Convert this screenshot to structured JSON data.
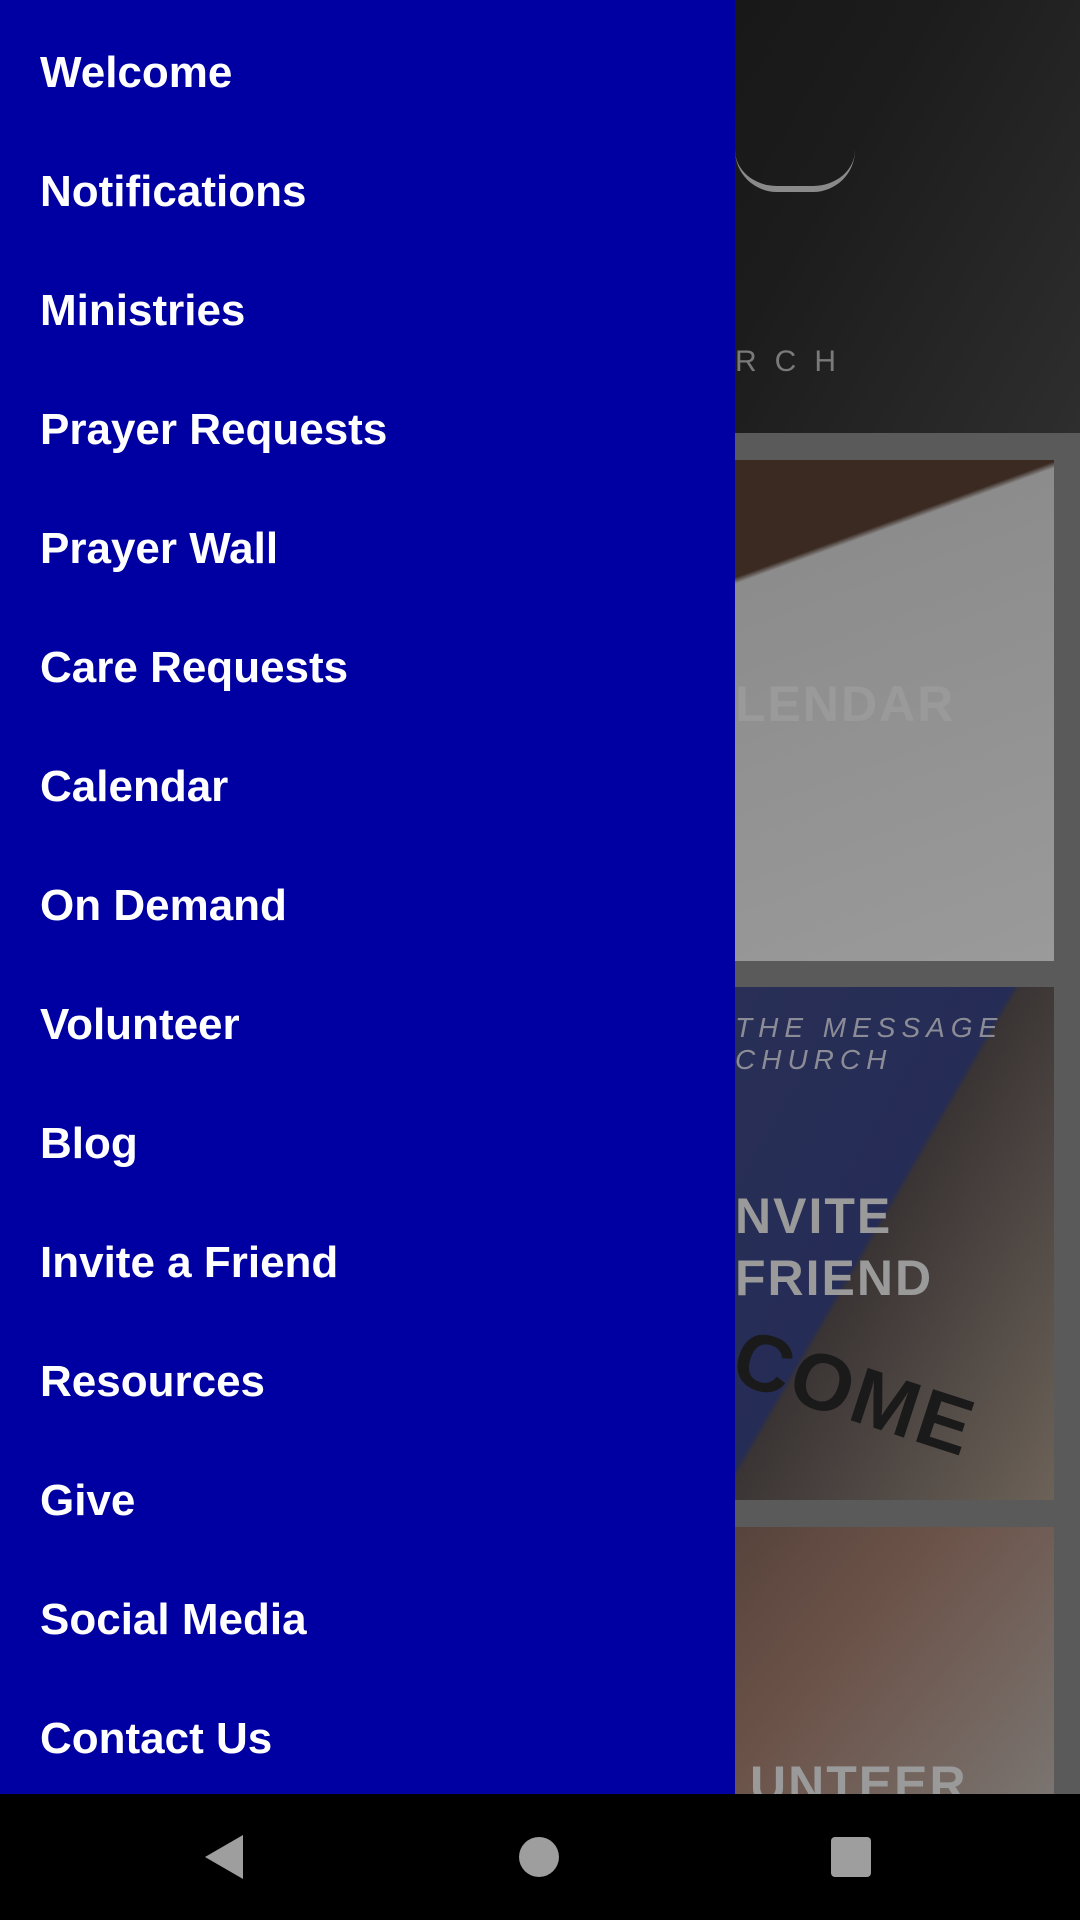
{
  "background": {
    "hero_text": "RCH",
    "cards": [
      {
        "lines": [
          "LENDAR"
        ]
      },
      {
        "caption": "THE MESSAGE CHURCH",
        "lines": [
          "NVITE",
          "FRIEND"
        ],
        "sign": "COME"
      },
      {
        "lines": [
          "UNTEER"
        ]
      }
    ]
  },
  "drawer": {
    "color": "#0000a2",
    "items": [
      {
        "label": "Welcome"
      },
      {
        "label": "Notifications"
      },
      {
        "label": "Ministries"
      },
      {
        "label": "Prayer Requests"
      },
      {
        "label": "Prayer Wall"
      },
      {
        "label": "Care Requests"
      },
      {
        "label": "Calendar"
      },
      {
        "label": "On Demand"
      },
      {
        "label": "Volunteer"
      },
      {
        "label": "Blog"
      },
      {
        "label": "Invite a Friend"
      },
      {
        "label": "Resources"
      },
      {
        "label": "Give"
      },
      {
        "label": "Social Media"
      },
      {
        "label": "Contact Us"
      }
    ]
  },
  "navbar": {
    "icons": [
      "back-triangle-icon",
      "home-circle-icon",
      "recents-square-icon"
    ]
  }
}
